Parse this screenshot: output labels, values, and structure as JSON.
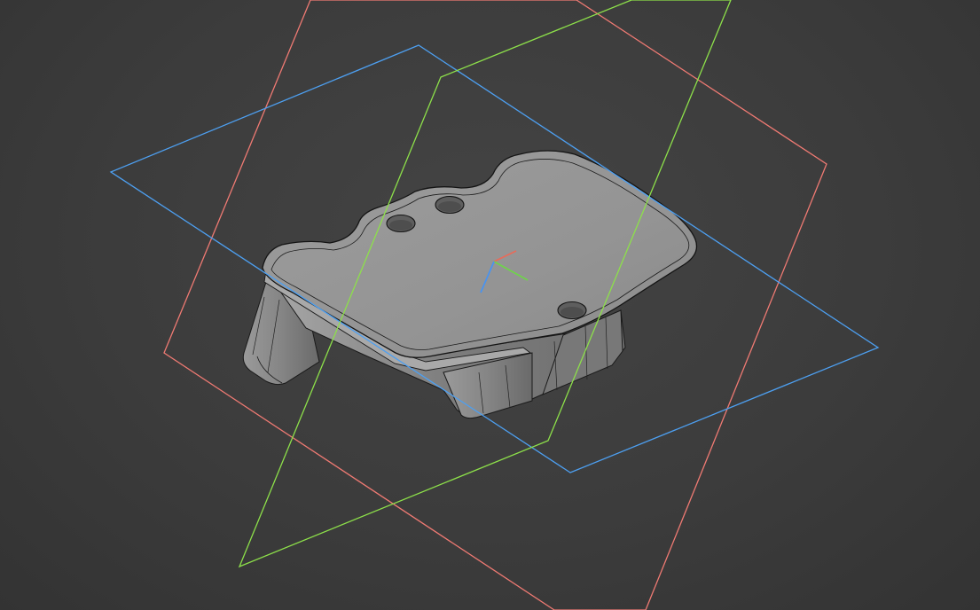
{
  "viewport": {
    "background": "#3c3c3c",
    "projection": "isometric"
  },
  "reference_planes": [
    {
      "name": "XY",
      "color": "#4d9ff0"
    },
    {
      "name": "YZ",
      "color": "#8de04a"
    },
    {
      "name": "XZ",
      "color": "#ef7a73"
    }
  ],
  "triad": {
    "x_color": "#e86b5a",
    "y_color": "#6fd34a",
    "z_color": "#4a93ee"
  },
  "part": {
    "body_color": "#8f8f8f",
    "edge_color": "#161616",
    "hole_count": 3
  }
}
